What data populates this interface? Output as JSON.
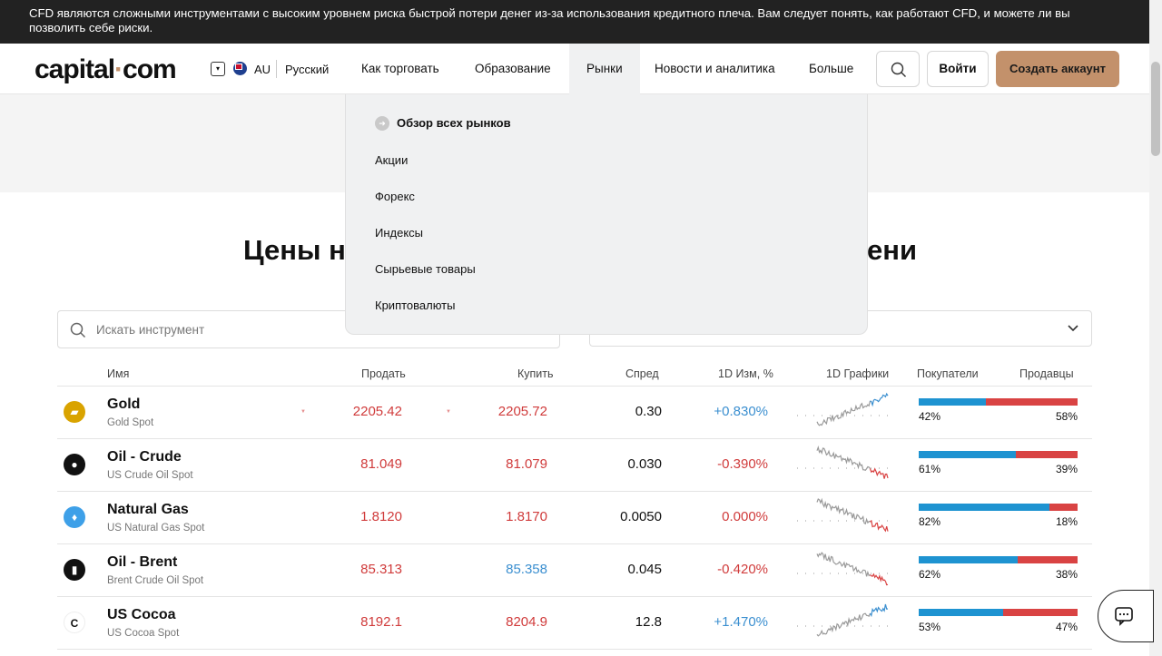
{
  "risk_warning": "CFD являются сложными инструментами с высоким уровнем риска быстрой потери денег из-за использования кредитного плеча. Вам следует понять, как работают CFD, и можете ли вы позволить себе риски.",
  "header": {
    "logo_left": "capital",
    "logo_dot": "·",
    "logo_right": "com",
    "region_code": "AU",
    "language": "Русский",
    "nav": [
      "Как торговать",
      "Образование",
      "Рынки",
      "Новости и аналитика",
      "Больше"
    ],
    "active_nav": "Рынки",
    "login": "Войти",
    "signup": "Создать аккаунт"
  },
  "markets_menu": {
    "overview": "Обзор всех рынков",
    "items": [
      "Акции",
      "Форекс",
      "Индексы",
      "Сырьевые товары",
      "Криптовалюты"
    ]
  },
  "section": {
    "title_left": "Цены н",
    "title_right": "ени"
  },
  "search": {
    "placeholder": "Искать инструмент"
  },
  "table": {
    "headers": {
      "name": "Имя",
      "sell": "Продать",
      "buy": "Купить",
      "spread": "Спред",
      "change": "1D Изм, %",
      "chart": "1D Графики",
      "buyers": "Покупатели",
      "sellers": "Продавцы"
    },
    "rows": [
      {
        "name": "Gold",
        "sub": "Gold Spot",
        "sell": "2205.42",
        "buy": "2205.72",
        "spread": "0.30",
        "change": "+0.830%",
        "buyers_pct": "42%",
        "sellers_pct": "58%",
        "buyers": 42,
        "trend": "up",
        "icon": "gold-icon",
        "icon_color": "#d9a300"
      },
      {
        "name": "Oil - Crude",
        "sub": "US Crude Oil Spot",
        "sell": "81.049",
        "buy": "81.079",
        "spread": "0.030",
        "change": "-0.390%",
        "buyers_pct": "61%",
        "sellers_pct": "39%",
        "buyers": 61,
        "trend": "down",
        "icon": "oil-drop-icon",
        "icon_color": "#111111"
      },
      {
        "name": "Natural Gas",
        "sub": "US Natural Gas Spot",
        "sell": "1.8120",
        "buy": "1.8170",
        "spread": "0.0050",
        "change": "0.000%",
        "buyers_pct": "82%",
        "sellers_pct": "18%",
        "buyers": 82,
        "trend": "down",
        "icon": "flame-icon",
        "icon_color": "#3ea0e8"
      },
      {
        "name": "Oil - Brent",
        "sub": "Brent Crude Oil Spot",
        "sell": "85.313",
        "buy": "85.358",
        "spread": "0.045",
        "change": "-0.420%",
        "buyers_pct": "62%",
        "sellers_pct": "38%",
        "buyers": 62,
        "trend": "down",
        "icon": "oil-barrel-icon",
        "icon_color": "#111111"
      },
      {
        "name": "US Cocoa",
        "sub": "US Cocoa Spot",
        "sell": "8192.1",
        "buy": "8204.9",
        "spread": "12.8",
        "change": "+1.470%",
        "buyers_pct": "53%",
        "sellers_pct": "47%",
        "buyers": 53,
        "trend": "up",
        "icon": "cocoa-icon",
        "icon_color": "#111111"
      }
    ]
  },
  "colors": {
    "accent": "#c3916b",
    "buyers": "#1e93d1",
    "sellers": "#d94343",
    "negative": "#d03b3b",
    "positive": "#3b8fd0"
  }
}
